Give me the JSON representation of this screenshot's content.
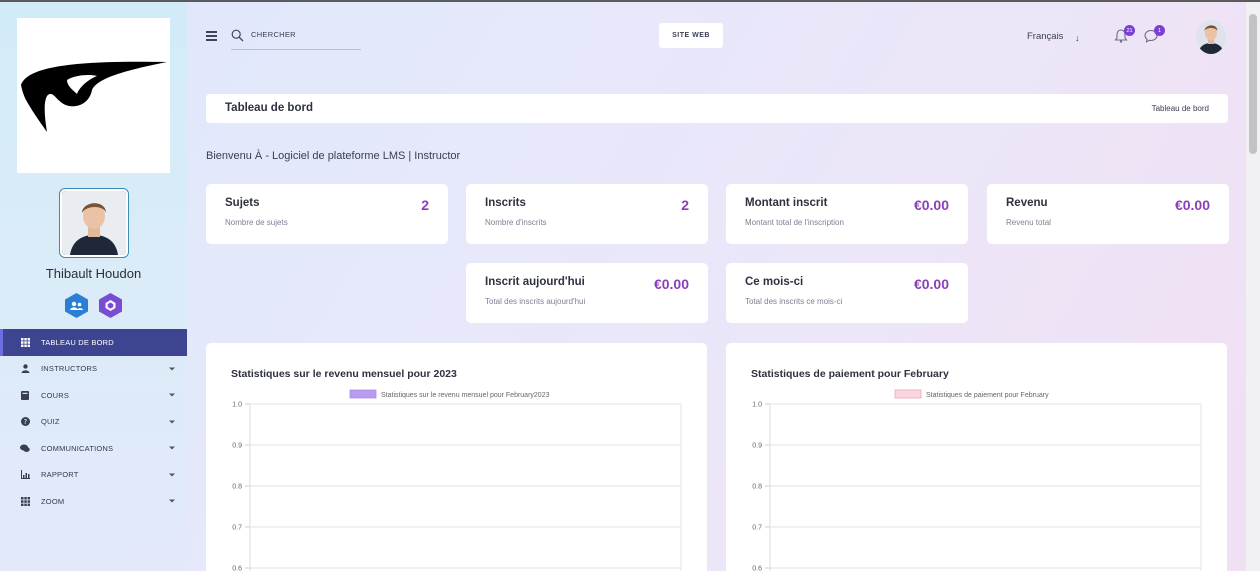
{
  "sidebar": {
    "user_name": "Thibault Houdon",
    "nav": [
      {
        "label": "TABLEAU DE BORD",
        "icon": "grid-icon",
        "active": true,
        "caret": false
      },
      {
        "label": "INSTRUCTORS",
        "icon": "user-icon",
        "active": false,
        "caret": true
      },
      {
        "label": "COURS",
        "icon": "book-icon",
        "active": false,
        "caret": true
      },
      {
        "label": "QUIZ",
        "icon": "question-icon",
        "active": false,
        "caret": true
      },
      {
        "label": "COMMUNICATIONS",
        "icon": "comments-icon",
        "active": false,
        "caret": true
      },
      {
        "label": "RAPPORT",
        "icon": "chart-icon",
        "active": false,
        "caret": true
      },
      {
        "label": "ZOOM",
        "icon": "grid-icon",
        "active": false,
        "caret": true
      }
    ]
  },
  "header": {
    "search_placeholder": "CHERCHER",
    "site_button": "SITE WEB",
    "language": "Français",
    "notifications_count": "21",
    "messages_count": "1"
  },
  "breadcrumb": {
    "title": "Tableau de bord",
    "link": "Tableau de bord"
  },
  "welcome": "Bienvenu À - Logiciel de plateforme LMS | Instructor",
  "cards": [
    {
      "title": "Sujets",
      "subtitle": "Nombre de sujets",
      "value": "2"
    },
    {
      "title": "Inscrits",
      "subtitle": "Nombre d'inscrits",
      "value": "2"
    },
    {
      "title": "Montant inscrit",
      "subtitle": "Montant total de l'inscription",
      "value": "€0.00"
    },
    {
      "title": "Revenu",
      "subtitle": "Revenu total",
      "value": "€0.00"
    },
    {
      "title": "Inscrit aujourd'hui",
      "subtitle": "Total des inscrits aujourd'hui",
      "value": "€0.00"
    },
    {
      "title": "Ce mois-ci",
      "subtitle": "Total des inscrits ce mois-ci",
      "value": "€0.00"
    }
  ],
  "colors": {
    "accent": "#8b3fb8",
    "sidebar_active": "#3d4591",
    "badge_blue": "#2a7fd4",
    "badge_purple": "#7a4bd3"
  },
  "chart_data": [
    {
      "type": "bar",
      "title": "Statistiques sur le revenu mensuel pour 2023",
      "legend": "Statistiques sur le revenu mensuel pour February2023",
      "legend_color": "#b79cf0",
      "categories": [],
      "values": [],
      "y_ticks": [
        "1.0",
        "0.9",
        "0.8",
        "0.7",
        "0.6"
      ],
      "ylim": [
        0.6,
        1.0
      ],
      "grid": true,
      "legend_position": "top"
    },
    {
      "type": "bar",
      "title": "Statistiques de paiement pour February",
      "legend": "Statistiques de paiement pour February",
      "legend_color": "#fbd6df",
      "categories": [],
      "values": [],
      "y_ticks": [
        "1.0",
        "0.9",
        "0.8",
        "0.7",
        "0.6"
      ],
      "ylim": [
        0.6,
        1.0
      ],
      "grid": true,
      "legend_position": "top"
    }
  ]
}
